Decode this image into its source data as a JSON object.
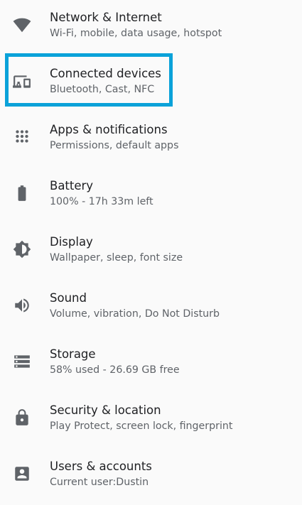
{
  "settings": {
    "items": [
      {
        "title": "Network & Internet",
        "summary": "Wi-Fi, mobile, data usage, hotspot",
        "icon": "wifi-icon"
      },
      {
        "title": "Connected devices",
        "summary": "Bluetooth, Cast, NFC",
        "icon": "devices-icon"
      },
      {
        "title": "Apps & notifications",
        "summary": "Permissions, default apps",
        "icon": "apps-grid-icon"
      },
      {
        "title": "Battery",
        "summary": "100% - 17h 33m left",
        "icon": "battery-icon"
      },
      {
        "title": "Display",
        "summary": "Wallpaper, sleep, font size",
        "icon": "brightness-icon"
      },
      {
        "title": "Sound",
        "summary": "Volume, vibration, Do Not Disturb",
        "icon": "volume-icon"
      },
      {
        "title": "Storage",
        "summary": "58% used - 26.69 GB free",
        "icon": "storage-icon"
      },
      {
        "title": "Security & location",
        "summary": "Play Protect, screen lock, fingerprint",
        "icon": "lock-icon"
      },
      {
        "title": "Users & accounts",
        "summary": "Current user:Dustin",
        "icon": "account-box-icon"
      }
    ],
    "highlighted_item": "Connected devices",
    "highlight_color": "#0aa2d9",
    "icon_color": "#5f6368",
    "title_color": "#202124",
    "summary_color": "#5f6368",
    "background_color": "#fafafa"
  }
}
